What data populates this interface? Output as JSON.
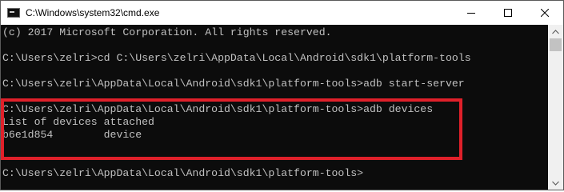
{
  "window": {
    "title": "C:\\Windows\\system32\\cmd.exe",
    "icon": "console-icon",
    "controls": [
      "minimize-icon",
      "maximize-icon",
      "close-icon"
    ]
  },
  "console": {
    "lines": [
      "(c) 2017 Microsoft Corporation. All rights reserved.",
      "",
      "C:\\Users\\zelri>cd C:\\Users\\zelri\\AppData\\Local\\Android\\sdk1\\platform-tools",
      "",
      "C:\\Users\\zelri\\AppData\\Local\\Android\\sdk1\\platform-tools>adb start-server",
      "",
      "C:\\Users\\zelri\\AppData\\Local\\Android\\sdk1\\platform-tools>adb devices",
      "List of devices attached",
      "b6e1d854        device",
      "",
      "",
      "C:\\Users\\zelri\\AppData\\Local\\Android\\sdk1\\platform-tools>"
    ],
    "text_color": "#c0c0c0",
    "background": "#0c0c0c"
  },
  "highlight": {
    "color": "#e0202a"
  },
  "scrollbar": {
    "thumb_position": 0
  }
}
